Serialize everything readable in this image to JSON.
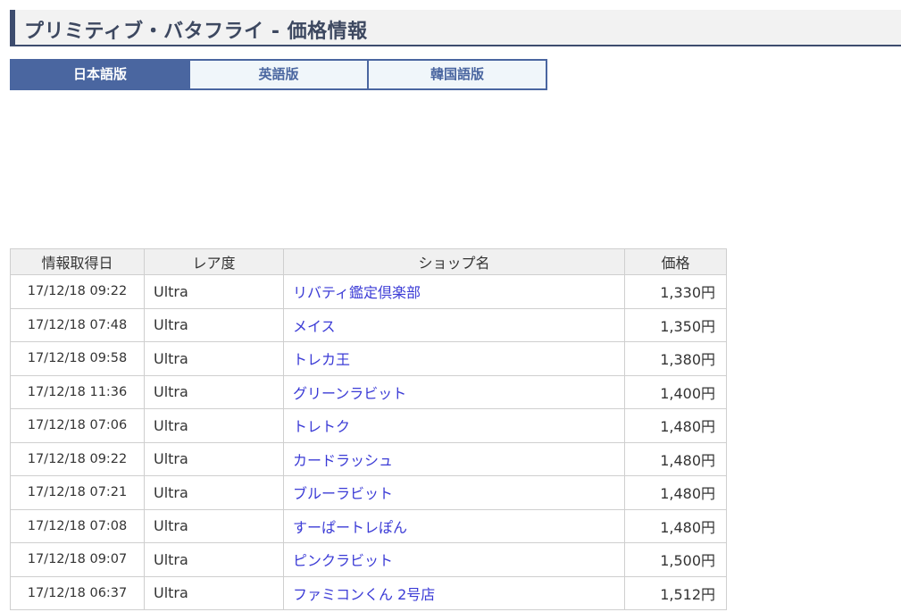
{
  "header": {
    "title": "プリミティブ・バタフライ - 価格情報"
  },
  "tabs": [
    {
      "label": "日本語版",
      "active": true
    },
    {
      "label": "英語版",
      "active": false
    },
    {
      "label": "韓国語版",
      "active": false
    }
  ],
  "table": {
    "columns": [
      "情報取得日",
      "レア度",
      "ショップ名",
      "価格"
    ],
    "rows": [
      {
        "date": "17/12/18 09:22",
        "rarity": "Ultra",
        "shop": "リバティ鑑定倶楽部",
        "price": "1,330円"
      },
      {
        "date": "17/12/18 07:48",
        "rarity": "Ultra",
        "shop": "メイス",
        "price": "1,350円"
      },
      {
        "date": "17/12/18 09:58",
        "rarity": "Ultra",
        "shop": "トレカ王",
        "price": "1,380円"
      },
      {
        "date": "17/12/18 11:36",
        "rarity": "Ultra",
        "shop": "グリーンラビット",
        "price": "1,400円"
      },
      {
        "date": "17/12/18 07:06",
        "rarity": "Ultra",
        "shop": "トレトク",
        "price": "1,480円"
      },
      {
        "date": "17/12/18 09:22",
        "rarity": "Ultra",
        "shop": "カードラッシュ",
        "price": "1,480円"
      },
      {
        "date": "17/12/18 07:21",
        "rarity": "Ultra",
        "shop": "ブルーラビット",
        "price": "1,480円"
      },
      {
        "date": "17/12/18 07:08",
        "rarity": "Ultra",
        "shop": "すーぱートレぽん",
        "price": "1,480円"
      },
      {
        "date": "17/12/18 09:07",
        "rarity": "Ultra",
        "shop": "ピンクラビット",
        "price": "1,500円"
      },
      {
        "date": "17/12/18 06:37",
        "rarity": "Ultra",
        "shop": "ファミコンくん 2号店",
        "price": "1,512円"
      }
    ]
  },
  "colors": {
    "accent": "#4a66a0",
    "header_border": "#3d4c6e",
    "link": "#3b3bd6"
  }
}
